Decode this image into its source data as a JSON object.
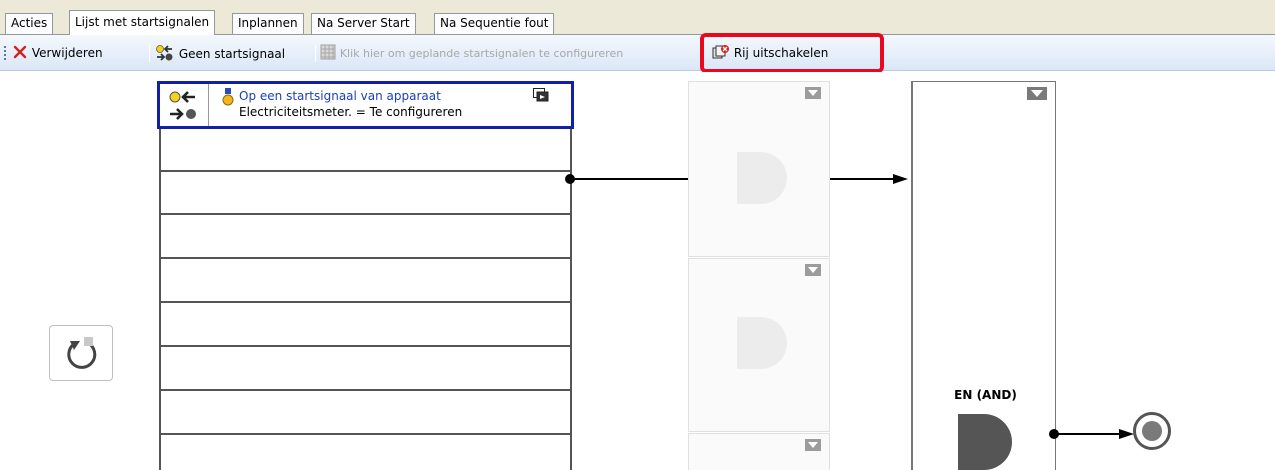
{
  "tabs": [
    {
      "label": "Acties",
      "active": false
    },
    {
      "label": "Lijst met startsignalen",
      "active": true
    },
    {
      "label": "Inplannen",
      "active": false
    },
    {
      "label": "Na Server Start",
      "active": false
    },
    {
      "label": "Na Sequentie fout",
      "active": false
    }
  ],
  "toolbar": {
    "delete_label": "Verwijderen",
    "no_start_signal_label": "Geen startsignaal",
    "configure_label": "Klik hier om geplande startsignalen te configureren",
    "disable_row_label": "Rij uitschakelen"
  },
  "signal": {
    "title": "Op een startsignaal van apparaat",
    "subtitle": "Electriciteitsmeter. = Te configureren"
  },
  "and_gate": {
    "label": "EN (AND)"
  },
  "colors": {
    "highlight": "#e8091f",
    "selected_border": "#1020a8",
    "link_text": "#1a3fbf"
  }
}
